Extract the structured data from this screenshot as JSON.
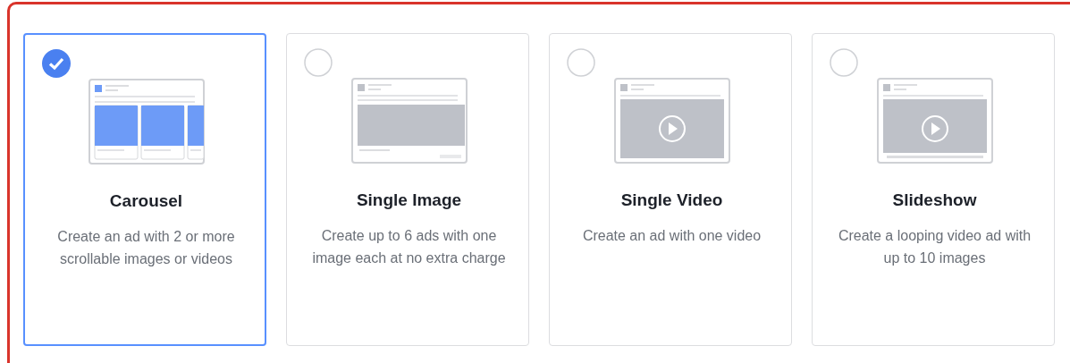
{
  "ad_formats": [
    {
      "kind": "carousel",
      "title": "Carousel",
      "description": "Create an ad with 2 or more scrollable images or videos",
      "selected": true
    },
    {
      "kind": "image",
      "title": "Single Image",
      "description": "Create up to 6 ads with one image each at no extra charge",
      "selected": false
    },
    {
      "kind": "video",
      "title": "Single Video",
      "description": "Create an ad with one video",
      "selected": false
    },
    {
      "kind": "slideshow",
      "title": "Slideshow",
      "description": "Create a looping video ad with up to 10 images",
      "selected": false
    }
  ]
}
